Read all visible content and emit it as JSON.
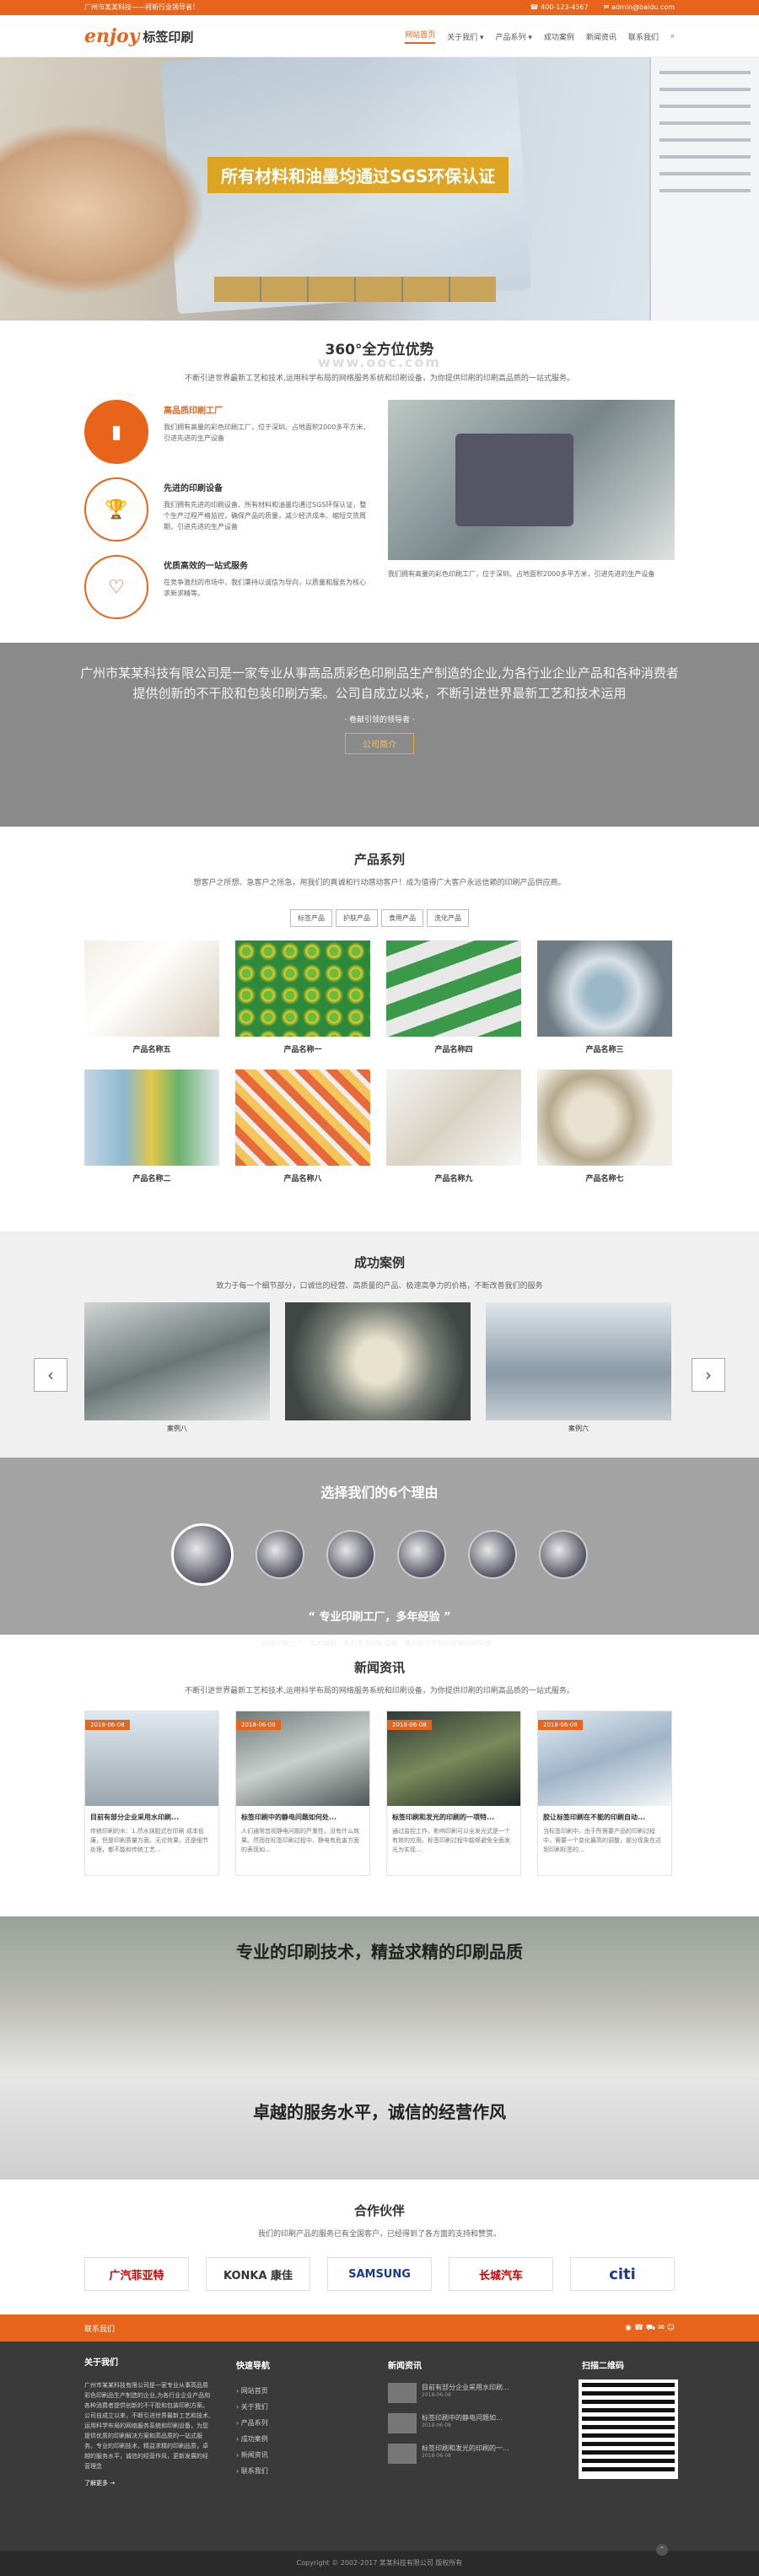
{
  "topbar": {
    "welcome": "广州市某某科技——柯新行业领导者！",
    "phone": "400-123-4567",
    "email": "admin@baidu.com"
  },
  "header": {
    "logo_en": "enjoy",
    "logo_cn": "标签印刷",
    "nav": [
      "网站首页",
      "关于我们",
      "产品系列",
      "成功案例",
      "新闻资讯",
      "联系我们"
    ],
    "active": 0
  },
  "banner": {
    "caption": "所有材料和油墨均通过SGS环保认证"
  },
  "adv": {
    "title": "360°全方位优势",
    "watermark": "www.ooc.com",
    "sub": "不断引进世界最新工艺和技术,运用科学布局的网络服务系统和印刷设备，为你提供印刷的印刷高品质的一站式服务。",
    "items": [
      {
        "title": "高品质印刷工厂",
        "text": "我们拥有高量的彩色印刷工厂，位于深圳、占地面积2000多平方米，引进先进的生产设备"
      },
      {
        "title": "先进的印刷设备",
        "text": "我们拥有先进的印刷设备、所有材料和油墨均通过SGS环保认证，整个生产过程严格监控，确保产品的质量，减少经济成本、缩短交货周期，引进先进的生产设备"
      },
      {
        "title": "优质高效的一站式服务",
        "text": "在竞争激烈的市场中，我们秉持以诚信为导向，以质量和服务为核心 求新求精等。"
      }
    ],
    "right_text": "我们拥有高量的彩色印刷工厂，位于深圳、占地面积2000多平方米，引进先进的生产设备"
  },
  "company": {
    "text": "广州市某某科技有限公司是一家专业从事高品质彩色印刷品生产制造的企业,为各行业企业产品和各种消费者提供创新的不干胶和包装印刷方案。公司自成立以来，不断引进世界最新工艺和技术运用",
    "tag": "· 卷献引领的领导者 ·",
    "btn": "公司简介"
  },
  "products": {
    "title": "产品系列",
    "sub": "想客户之所想、急客户之所急，用我们的真诚和行动感动客户！成为值得广大客户永远信赖的印刷产品供应商。",
    "tabs": [
      "标签产品",
      "护肤产品",
      "食用产品",
      "洗化产品"
    ],
    "items": [
      "产品名称五",
      "产品名称一",
      "产品名称四",
      "产品名称三",
      "产品名称二",
      "产品名称八",
      "产品名称九",
      "产品名称七"
    ]
  },
  "cases": {
    "title": "成功案例",
    "sub": "致力于每一个细节部分，口诚信的经营、高质量的产品、极速高争力的价格，不断改善我们的服务",
    "items": [
      "案例八",
      "",
      "案例六"
    ],
    "prev": "‹",
    "next": "›"
  },
  "reasons": {
    "title": "选择我们的6个理由",
    "subtitle": "专业印刷工厂，多年经验",
    "text": "10年印刷工厂，实力雄厚。多台专业印刷设备，满足客户不同的印刷印刷需要。"
  },
  "news": {
    "title": "新闻资讯",
    "sub": "不断引进世界最新工艺和技术,运用科学布局的网络服务系统和印刷设备，为你提供印刷的印刷高品质的一站式服务。",
    "items": [
      {
        "date": "2018-06-08",
        "title": "目前有部分企业采用水印刷...",
        "text": "传统印刷的水：1.然水抹胶式在印刷 成本低廉，但是印刷质量方面，无论效果，还是细节处理，都不能和传统工艺..."
      },
      {
        "date": "2018-06-08",
        "title": "标签印刷中的静电问题如何处...",
        "text": "人们通常忽视静电问题的严重性，没有什么效果。然而在标签印刷过程中，静电有危害方面的表现如..."
      },
      {
        "date": "2018-06-08",
        "title": "标签印刷和发光的印刷的一项特...",
        "text": "通过监控工作，影响印刷可以全发光式是一个有效的应用。标签印刷过程中能够避免全面发光为实现..."
      },
      {
        "date": "2018-06-08",
        "title": "胶让标签印刷在不能的印刷自动...",
        "text": "当标签印刷中，由于所需要产品的印刷过程中，需要一个变化最高的调整，部分现象在达到印刷标签的..."
      }
    ]
  },
  "slogans": {
    "a": "专业的印刷技术，精益求精的印刷品质",
    "b": "卓越的服务水平，诚信的经营作风"
  },
  "partners": {
    "title": "合作伙伴",
    "sub": "我们的印刷产品的服务已有全国客户，已经得到了各方面的支持和赞赏。",
    "logos": [
      "广汽菲亚特",
      "KONKA 康佳",
      "SAMSUNG",
      "长城汽车",
      "citi"
    ]
  },
  "footer": {
    "bar_label": "联系我们",
    "about_t": "关于我们",
    "about": "广州市某某科技有限公司是一家专业从事高品质彩色印刷品生产制造的企业,为各行业企业产品和各种消费者提供创新的不干胶和包装印刷方案。公司自成立以来，不断引进世界最新工艺和技术,运用科学布局的网络服务系统和印刷设备，为您提供优质的印刷解决方案和高品质的一站式服务。专业的印刷技术，精益求精的印刷品质，卓越的服务水平，诚信的经营作风，更新发展的经营理念",
    "more": "了解更多 →",
    "nav_t": "快速导航",
    "nav": [
      "网站首页",
      "关于我们",
      "产品系列",
      "成功案例",
      "新闻资讯",
      "联系我们"
    ],
    "news_t": "新闻资讯",
    "news": [
      {
        "t": "目前有部分企业采用水印刷...",
        "d": "2018-06-08"
      },
      {
        "t": "标签印刷中的静电问题如...",
        "d": "2018-06-08"
      },
      {
        "t": "标签印刷和发光的印刷的一...",
        "d": "2018-06-08"
      }
    ],
    "qr_t": "扫描二维码",
    "copy": "Copyright © 2002-2017 某某科技有限公司 版权所有"
  }
}
